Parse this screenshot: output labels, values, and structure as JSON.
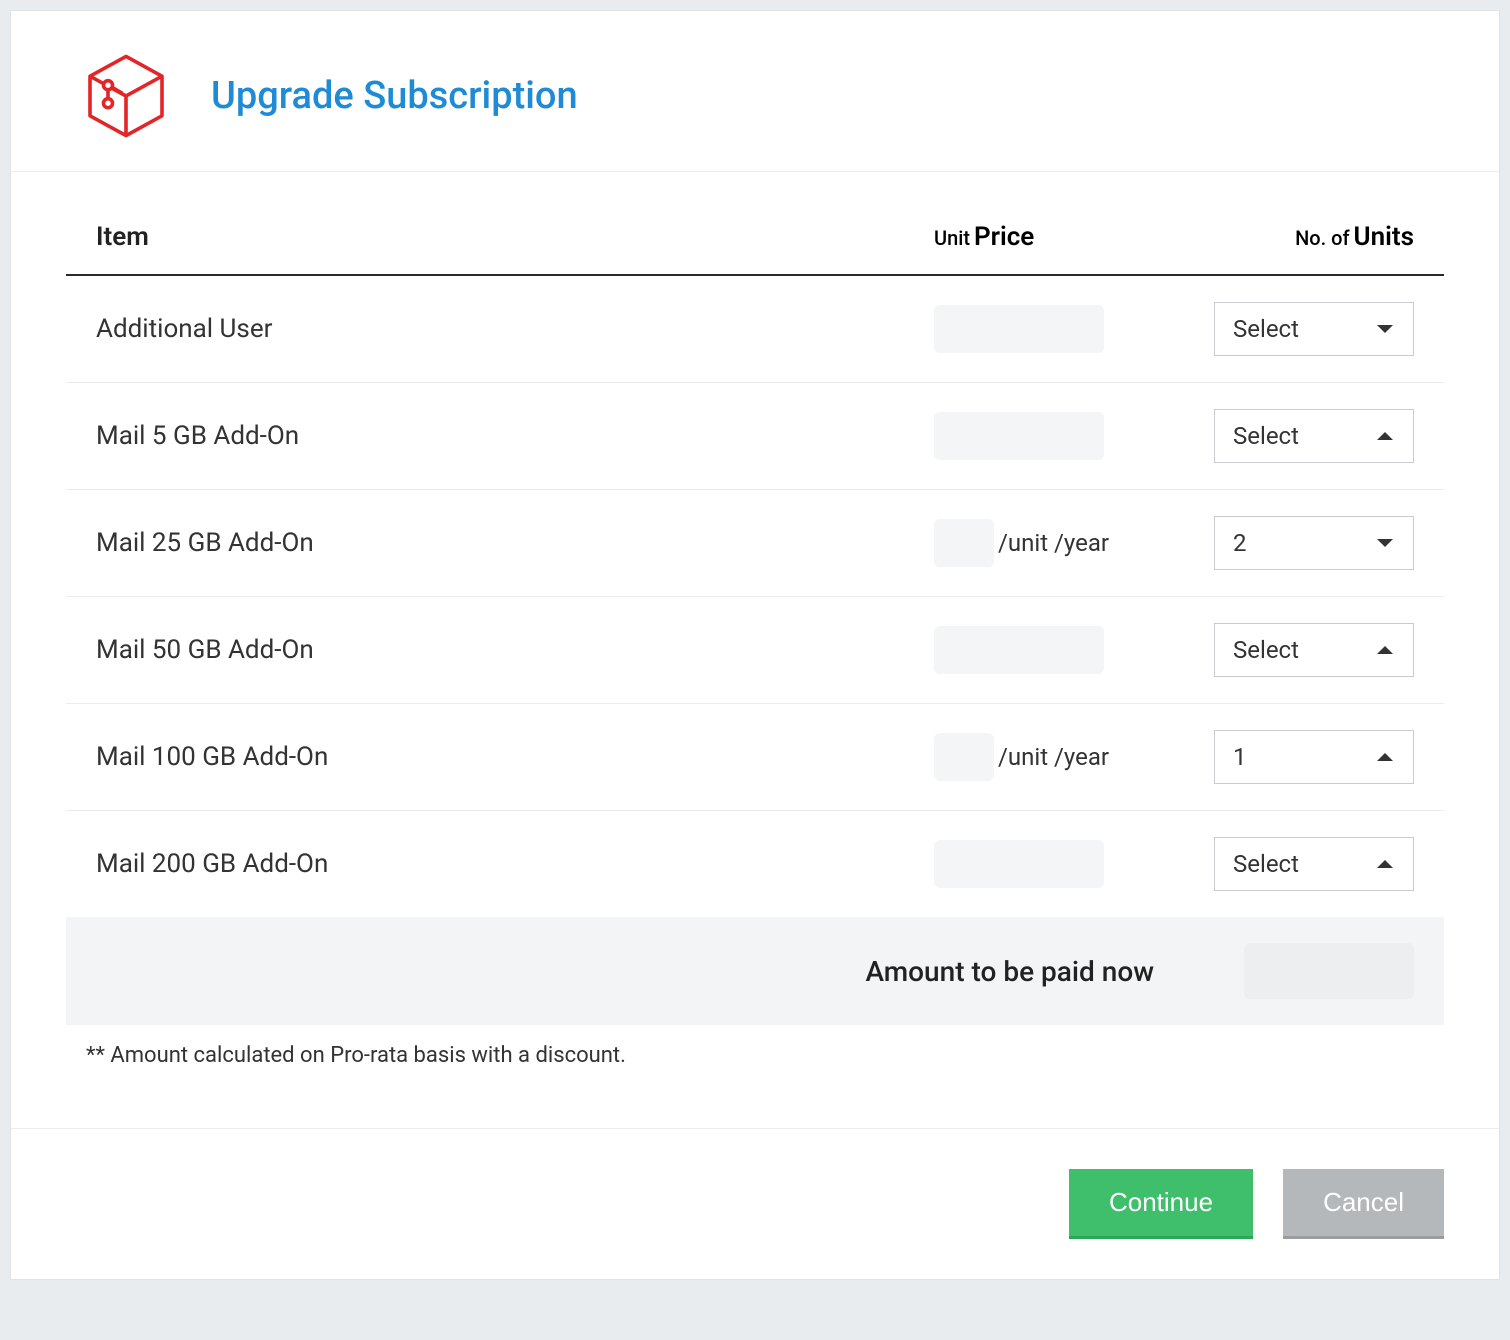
{
  "header": {
    "title": "Upgrade Subscription"
  },
  "table": {
    "columns": {
      "item": "Item",
      "unit": "Unit",
      "price": "Price",
      "no_of": "No. of",
      "units": "Units"
    },
    "rows": [
      {
        "name": "Additional User",
        "price_suffix": "",
        "select_value": "Select",
        "caret": "down"
      },
      {
        "name": "Mail 5 GB Add-On",
        "price_suffix": "",
        "select_value": "Select",
        "caret": "up"
      },
      {
        "name": "Mail 25 GB Add-On",
        "price_suffix": "/unit /year",
        "select_value": "2",
        "caret": "down"
      },
      {
        "name": "Mail 50 GB Add-On",
        "price_suffix": "",
        "select_value": "Select",
        "caret": "up"
      },
      {
        "name": "Mail 100 GB Add-On",
        "price_suffix": "/unit /year",
        "select_value": "1",
        "caret": "up"
      },
      {
        "name": "Mail 200 GB Add-On",
        "price_suffix": "",
        "select_value": "Select",
        "caret": "up"
      }
    ]
  },
  "total": {
    "label": "Amount to be paid now"
  },
  "footnote": "** Amount calculated on Pro-rata basis with a discount.",
  "footer": {
    "continue": "Continue",
    "cancel": "Cancel"
  }
}
